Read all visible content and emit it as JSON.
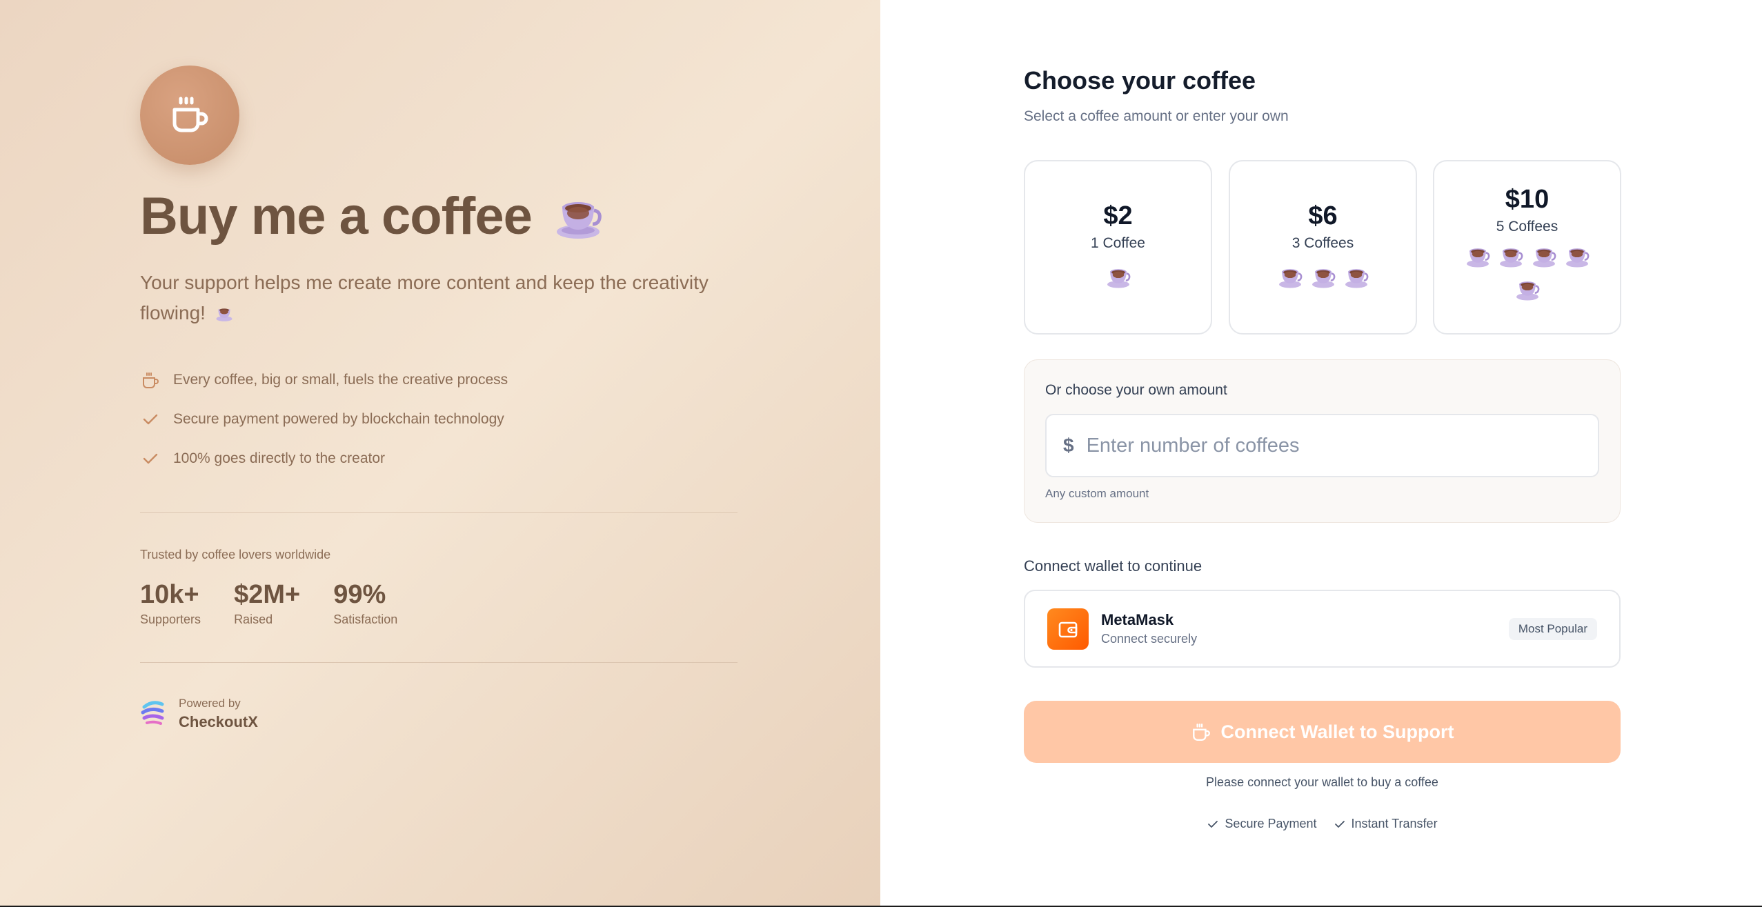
{
  "hero": {
    "title": "Buy me a coffee",
    "subtitle": "Your support helps me create more content and keep the creativity flowing!",
    "icon": "coffee-mug-icon"
  },
  "features": [
    {
      "icon": "coffee-cup-icon",
      "text": "Every coffee, big or small, fuels the creative process"
    },
    {
      "icon": "check-icon",
      "text": "Secure payment powered by blockchain technology"
    },
    {
      "icon": "check-icon",
      "text": "100% goes directly to the creator"
    }
  ],
  "trust": {
    "label": "Trusted by coffee lovers worldwide",
    "stats": [
      {
        "value": "10k+",
        "label": "Supporters"
      },
      {
        "value": "$2M+",
        "label": "Raised"
      },
      {
        "value": "99%",
        "label": "Satisfaction"
      }
    ]
  },
  "powered": {
    "prefix": "Powered by",
    "brand": "CheckoutX"
  },
  "choose": {
    "title": "Choose your coffee",
    "subtitle": "Select a coffee amount or enter your own"
  },
  "options": [
    {
      "price": "$2",
      "label": "1 Coffee",
      "cups": 1
    },
    {
      "price": "$6",
      "label": "3 Coffees",
      "cups": 3
    },
    {
      "price": "$10",
      "label": "5 Coffees",
      "cups": 5
    }
  ],
  "custom": {
    "label": "Or choose your own amount",
    "currency": "$",
    "placeholder": "Enter number of coffees",
    "value": "",
    "hint": "Any custom amount"
  },
  "wallet_section": {
    "label": "Connect wallet to continue",
    "name": "MetaMask",
    "sub": "Connect securely",
    "badge": "Most Popular"
  },
  "cta": {
    "label": "Connect Wallet to Support",
    "hint": "Please connect your wallet to buy a coffee",
    "color": "#ffc7a6"
  },
  "guarantees": [
    "Secure Payment",
    "Instant Transfer"
  ],
  "colors": {
    "accent": "#c58b67",
    "brand_text": "#6e5440",
    "metamask": "#ff6a00"
  }
}
